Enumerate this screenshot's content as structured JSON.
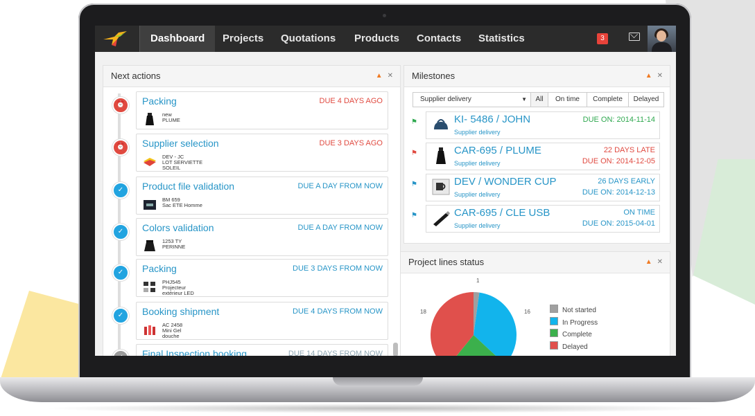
{
  "nav": {
    "items": [
      "Dashboard",
      "Projects",
      "Quotations",
      "Products",
      "Contacts",
      "Statistics"
    ],
    "active": "Dashboard",
    "notification_count": "3",
    "icons": {
      "mail": "envelope-icon",
      "logo": "hummingbird-logo"
    }
  },
  "next_actions": {
    "title": "Next actions",
    "items": [
      {
        "title": "Packing",
        "due": "DUE 4 DAYS AGO",
        "desc": [
          "new",
          "PLUME"
        ],
        "status": "overdue"
      },
      {
        "title": "Supplier selection",
        "due": "DUE 3 DAYS AGO",
        "desc": [
          "DEV - JC",
          "LOT SERVIETTE",
          "SOLEIL"
        ],
        "status": "overdue"
      },
      {
        "title": "Product file validation",
        "due": "DUE A DAY FROM NOW",
        "desc": [
          "BM 659",
          "Sac ETE Homme"
        ],
        "status": "upcoming"
      },
      {
        "title": "Colors validation",
        "due": "DUE A DAY FROM NOW",
        "desc": [
          "1253 TY",
          "PERINNE"
        ],
        "status": "upcoming"
      },
      {
        "title": "Packing",
        "due": "DUE 3 DAYS FROM NOW",
        "desc": [
          "PHJ545",
          "Projecteur",
          "extérieur LED"
        ],
        "status": "upcoming"
      },
      {
        "title": "Booking shipment",
        "due": "DUE 4 DAYS FROM NOW",
        "desc": [
          "AC 2458",
          "Mini Gel",
          "douche"
        ],
        "status": "upcoming"
      },
      {
        "title": "Final Inspection booking",
        "due": "DUE 14 DAYS FROM NOW",
        "desc": [],
        "status": "later"
      }
    ]
  },
  "milestones": {
    "title": "Milestones",
    "select": "Supplier delivery",
    "filters": [
      "All",
      "On time",
      "Complete",
      "Delayed"
    ],
    "items": [
      {
        "name": "KI- 5486 / JOHN",
        "sub": "Supplier delivery",
        "status": "",
        "due": "DUE ON: 2014-11-14",
        "color": "green"
      },
      {
        "name": "CAR-695 / PLUME",
        "sub": "Supplier delivery",
        "status": "22 DAYS LATE",
        "due": "DUE ON: 2014-12-05",
        "color": "red"
      },
      {
        "name": "DEV / WONDER CUP",
        "sub": "Supplier delivery",
        "status": "26 DAYS EARLY",
        "due": "DUE ON: 2014-12-13",
        "color": "blue"
      },
      {
        "name": "CAR-695 / CLE USB",
        "sub": "Supplier delivery",
        "status": "ON TIME",
        "due": "DUE ON: 2015-04-01",
        "color": "blue"
      }
    ]
  },
  "project_lines": {
    "title": "Project lines status"
  },
  "chart_data": {
    "type": "pie",
    "title": "Project lines status",
    "categories": [
      "Not started",
      "In Progress",
      "Complete",
      "Delayed"
    ],
    "values": [
      1,
      16,
      11,
      18
    ],
    "data_labels": [
      "1",
      "16",
      "18"
    ],
    "colors": [
      "#a0a0a0",
      "#12b4ec",
      "#3cb04c",
      "#e0504c"
    ],
    "legend": "right"
  }
}
